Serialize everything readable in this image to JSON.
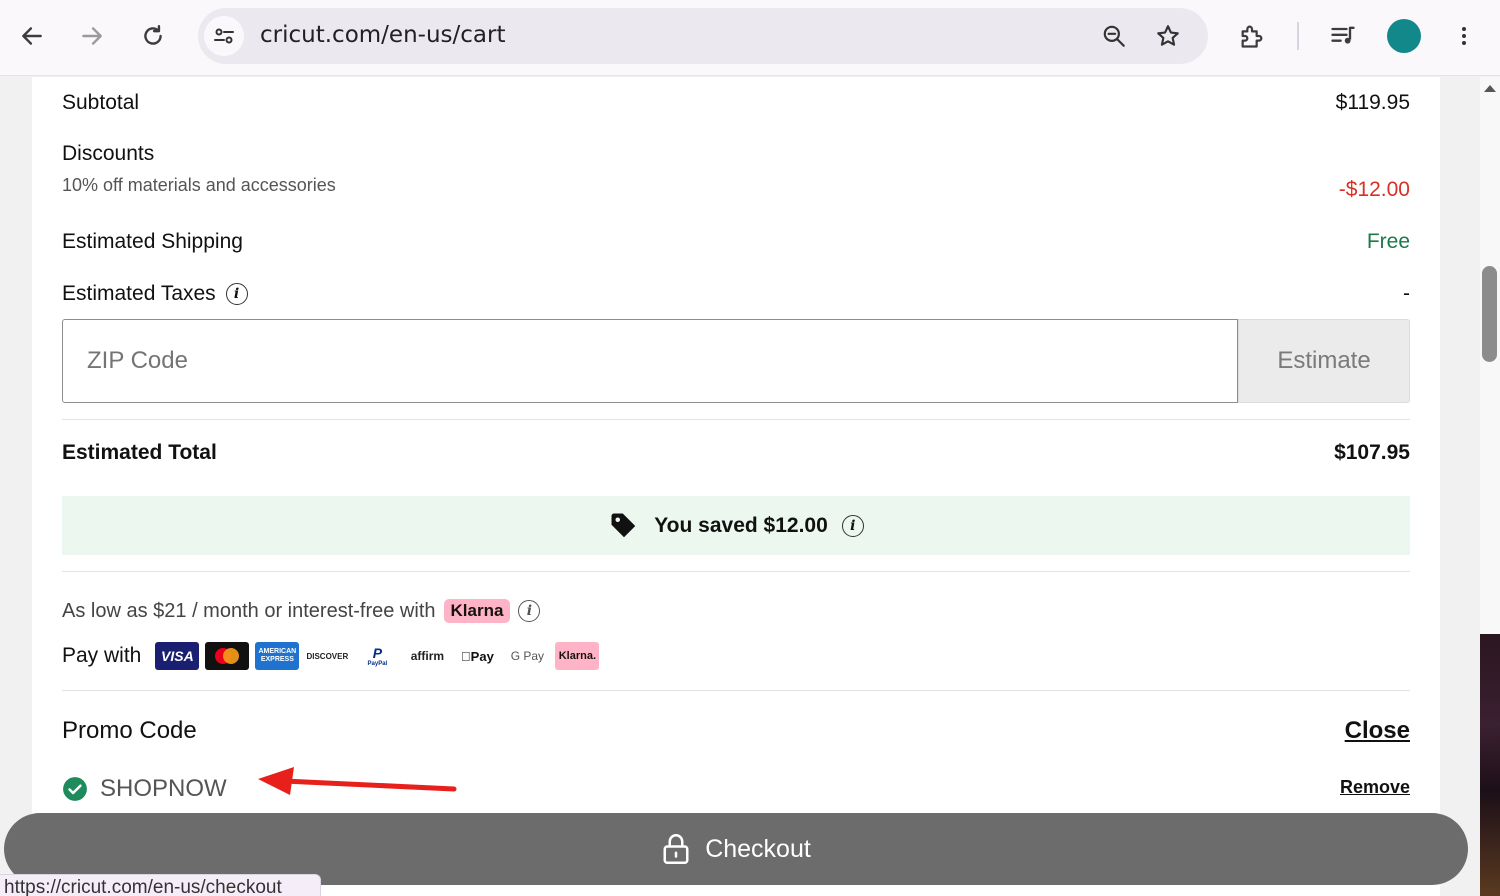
{
  "browser": {
    "url": "cricut.com/en-us/cart"
  },
  "summary": {
    "subtotal_label": "Subtotal",
    "subtotal_value": "$119.95",
    "discounts_label": "Discounts",
    "discounts_detail": "10% off materials and accessories",
    "discounts_value": "-$12.00",
    "shipping_label": "Estimated Shipping",
    "shipping_value": "Free",
    "taxes_label": "Estimated Taxes",
    "taxes_value": "-",
    "zip_placeholder": "ZIP Code",
    "estimate_label": "Estimate",
    "total_label": "Estimated Total",
    "total_value": "$107.95",
    "saved_text": "You saved $12.00"
  },
  "financing": {
    "text": "As low as $21 / month or interest-free with",
    "klarna_label": "Klarna",
    "pay_with_label": "Pay with",
    "payment_methods": [
      "VISA",
      "mastercard",
      "AMERICAN EXPRESS",
      "DISCOVER",
      "PayPal",
      "affirm",
      "Pay",
      "G Pay",
      "Klarna."
    ]
  },
  "promo": {
    "title": "Promo Code",
    "close_label": "Close",
    "code": "SHOPNOW",
    "remove_label": "Remove"
  },
  "checkout": {
    "label": "Checkout"
  },
  "status_bar": {
    "url": "https://cricut.com/en-us/checkout"
  },
  "colors": {
    "discount_red": "#d93025",
    "free_green": "#1b7a4a",
    "check_green": "#1f8a5a",
    "saved_bg": "#ecf7ef",
    "checkout_bg": "#6c6c6c",
    "annotation_arrow": "#e8201c",
    "profile": "#12888b"
  }
}
